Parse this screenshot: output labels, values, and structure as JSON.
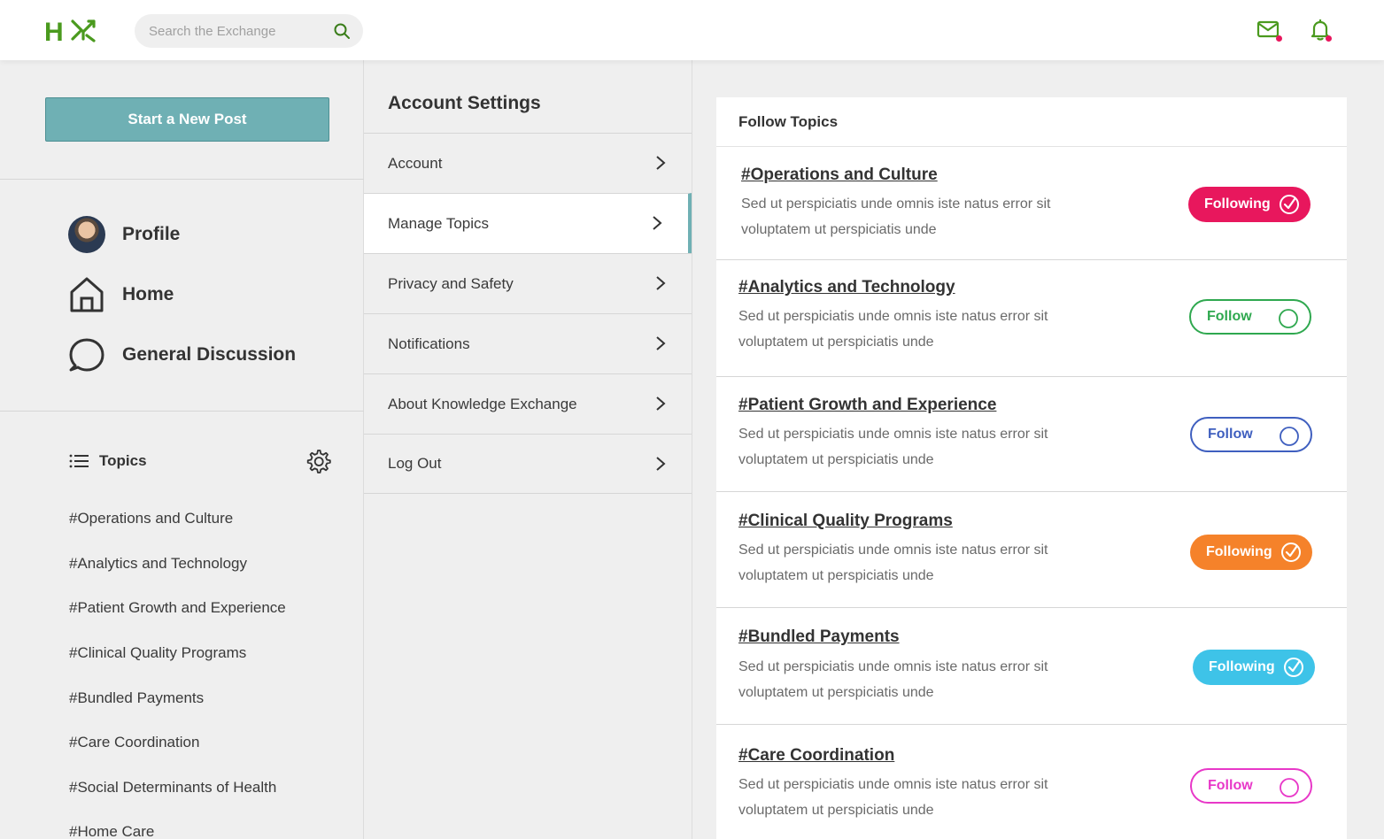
{
  "header": {
    "search_placeholder": "Search the Exchange",
    "logo_text": "HX"
  },
  "sidebar": {
    "new_post_label": "Start a New Post",
    "nav": [
      {
        "label": "Profile",
        "icon": "avatar"
      },
      {
        "label": "Home",
        "icon": "home-icon"
      },
      {
        "label": "General Discussion",
        "icon": "chat-bubble-icon"
      }
    ],
    "topics_title": "Topics",
    "topics": [
      "#Operations and Culture",
      "#Analytics and Technology",
      "#Patient Growth and Experience",
      "#Clinical Quality Programs",
      "#Bundled Payments",
      "#Care Coordination",
      "#Social Determinants of Health",
      "#Home Care"
    ]
  },
  "settings": {
    "title": "Account Settings",
    "menu": [
      "Account",
      "Manage Topics",
      "Privacy and Safety",
      "Notifications",
      "About Knowledge Exchange",
      "Log Out"
    ],
    "active": "Manage Topics"
  },
  "follow": {
    "title": "Follow Topics",
    "items": [
      {
        "title": "#Operations and Culture",
        "desc": "Sed ut perspiciatis unde omnis iste natus error sit voluptatem ut perspiciatis unde",
        "state": "Following",
        "color": "#e8175d"
      },
      {
        "title": "#Analytics and Technology",
        "desc": "Sed ut perspiciatis unde omnis iste natus error sit voluptatem ut perspiciatis unde",
        "state": "Follow",
        "color": "#2fa84f"
      },
      {
        "title": "#Patient Growth and Experience",
        "desc": "Sed ut perspiciatis unde omnis iste natus error sit voluptatem ut perspiciatis unde",
        "state": "Follow",
        "color": "#3f5fbf"
      },
      {
        "title": "#Clinical Quality Programs",
        "desc": "Sed ut perspiciatis unde omnis iste natus error sit voluptatem ut perspiciatis unde",
        "state": "Following",
        "color": "#f5822a"
      },
      {
        "title": "#Bundled Payments",
        "desc": "Sed ut perspiciatis unde omnis iste natus error sit voluptatem ut perspiciatis unde",
        "state": "Following",
        "color": "#3ec3e8"
      },
      {
        "title": "#Care Coordination",
        "desc": "Sed ut perspiciatis unde omnis iste natus error sit voluptatem ut perspiciatis unde",
        "state": "Follow",
        "color": "#e838c8"
      }
    ]
  },
  "colors": {
    "brand_green": "#4a9a1e",
    "accent_teal": "#6fb0b4",
    "notification_dot": "#e8175d"
  }
}
